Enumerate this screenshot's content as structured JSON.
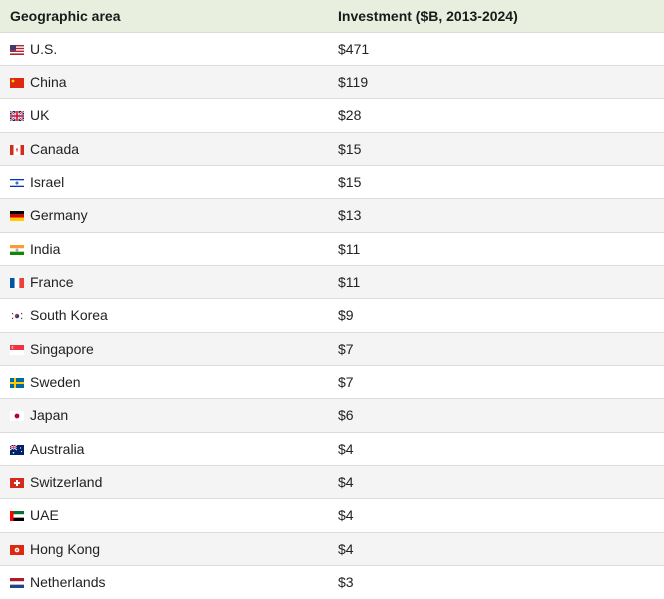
{
  "table": {
    "headers": [
      "Geographic area",
      "Investment ($B, 2013-2024)"
    ],
    "rows": [
      {
        "country": "U.S.",
        "value": "$471",
        "flag": "us-flag-icon"
      },
      {
        "country": "China",
        "value": "$119",
        "flag": "china-flag-icon"
      },
      {
        "country": "UK",
        "value": "$28",
        "flag": "uk-flag-icon"
      },
      {
        "country": "Canada",
        "value": "$15",
        "flag": "canada-flag-icon"
      },
      {
        "country": "Israel",
        "value": "$15",
        "flag": "israel-flag-icon"
      },
      {
        "country": "Germany",
        "value": "$13",
        "flag": "germany-flag-icon"
      },
      {
        "country": "India",
        "value": "$11",
        "flag": "india-flag-icon"
      },
      {
        "country": "France",
        "value": "$11",
        "flag": "france-flag-icon"
      },
      {
        "country": "South Korea",
        "value": "$9",
        "flag": "south-korea-flag-icon"
      },
      {
        "country": "Singapore",
        "value": "$7",
        "flag": "singapore-flag-icon"
      },
      {
        "country": "Sweden",
        "value": "$7",
        "flag": "sweden-flag-icon"
      },
      {
        "country": "Japan",
        "value": "$6",
        "flag": "japan-flag-icon"
      },
      {
        "country": "Australia",
        "value": "$4",
        "flag": "australia-flag-icon"
      },
      {
        "country": "Switzerland",
        "value": "$4",
        "flag": "switzerland-flag-icon"
      },
      {
        "country": "UAE",
        "value": "$4",
        "flag": "uae-flag-icon"
      },
      {
        "country": "Hong Kong",
        "value": "$4",
        "flag": "hong-kong-flag-icon"
      },
      {
        "country": "Netherlands",
        "value": "$3",
        "flag": "netherlands-flag-icon"
      }
    ]
  },
  "colors": {
    "header_bg": "#e8efdf",
    "stripe_bg": "#f4f4f4",
    "border": "#dcdcdc"
  }
}
